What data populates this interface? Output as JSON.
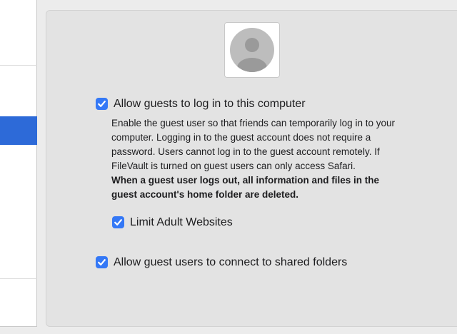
{
  "theme": {
    "accent": "#3478f6",
    "sidebar_selection": "#2d6ad8",
    "avatar_bg": "#bdbdbd",
    "avatar_fg": "#9a9a9a"
  },
  "avatar": {
    "icon": "user-silhouette-icon"
  },
  "options": {
    "allow_guests": {
      "label": "Allow guests to log in to this computer",
      "checked": true
    },
    "description_lines": [
      "Enable the guest user so that friends can temporarily log in to your",
      "computer. Logging in to the guest account does not require a",
      "password. Users cannot log in to the guest account remotely. If",
      "FileVault is turned on guest users can only access Safari."
    ],
    "warning_lines": [
      "When a guest user logs out, all information and files in the",
      "guest account's home folder are deleted."
    ],
    "limit_adult": {
      "label": "Limit Adult Websites",
      "checked": true
    },
    "shared_folders": {
      "label": "Allow guest users to connect to shared folders",
      "checked": true
    }
  }
}
